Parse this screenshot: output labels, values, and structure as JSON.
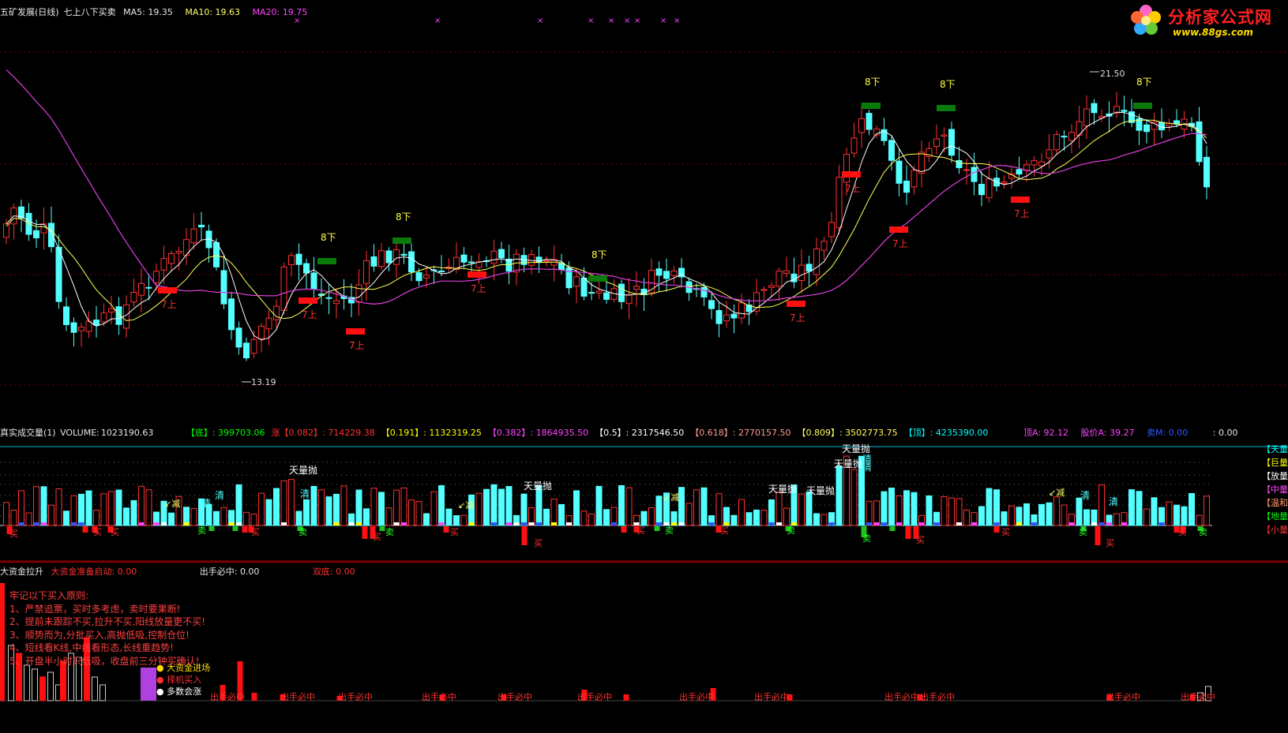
{
  "main": {
    "title": "五矿发展(日线)",
    "indicator": "七上八下买卖",
    "ma5_label": "MA5:",
    "ma5": "19.35",
    "ma10_label": "MA10:",
    "ma10": "19.63",
    "ma20_label": "MA20:",
    "ma20": "19.75",
    "low_marker": "13.19",
    "high_marker": "21.50",
    "signal_up": "7上",
    "signal_down": "8下"
  },
  "volume": {
    "title": "真实成交量(1)",
    "volume_label": "VOLUME:",
    "volume_value": "1023190.63",
    "levels": [
      {
        "label": "【底】",
        "value": ": 399703.06",
        "color": "#00ff00"
      },
      {
        "label": "涨【0.082】",
        "value": ": 714229.38",
        "color": "#ff3030"
      },
      {
        "label": "【0.191】",
        "value": ": 1132319.25",
        "color": "#ffff00"
      },
      {
        "label": "【0.382】",
        "value": ": 1864935.50",
        "color": "#ff44ff"
      },
      {
        "label": "【0.5】",
        "value": ": 2317546.50",
        "color": "#ffffff"
      },
      {
        "label": "【0.618】",
        "value": ": 2770157.50",
        "color": "#ff9a9a"
      },
      {
        "label": "【0.809】",
        "value": ": 3502773.75",
        "color": "#ffff60"
      },
      {
        "label": "【顶】",
        "value": ": 4235390.00",
        "color": "#00ffff"
      }
    ],
    "top_a_label": "顶A:",
    "top_a": "92.12",
    "price_a_label": "股价A:",
    "price_a": "39.27",
    "sell_label": "卖M:",
    "sell": "0.00",
    "extra": ": 0.00",
    "right_legend": [
      "【天量",
      "【巨量",
      "【放量",
      "【中量",
      "【温和",
      "【地量",
      "【小量"
    ],
    "label_throw": "天量抛",
    "label_clear": "清",
    "label_reduce": "减",
    "label_buy": "买",
    "label_sell": "卖"
  },
  "bottom": {
    "title": "大资金拉升",
    "start_label": "大资金准备启动:",
    "start_value": "0.00",
    "hit_label": "出手必中:",
    "hit_value": "0.00",
    "double_label": "双底:",
    "double_value": "0.00",
    "rules_title": "牢记以下买入原则:",
    "rules": [
      "1、严禁追票，买时多考虑，卖时要果断!",
      "2、提前未跟踪不买,拉升不买,阳线放量更不买!",
      "3、顺势而为,分批买入,高抛低吸,控制仓位!",
      "4、短线看K线,中线看形态,长线重趋势!",
      "5、开盘半小时只低吸，收盘前三分钟买确认!"
    ],
    "legend": [
      "大资金进场",
      "择机买入",
      "多数会涨"
    ],
    "hit_text": "出手必中"
  },
  "logo": {
    "text": "分析家公式网",
    "url": "www.88gs.com"
  }
}
